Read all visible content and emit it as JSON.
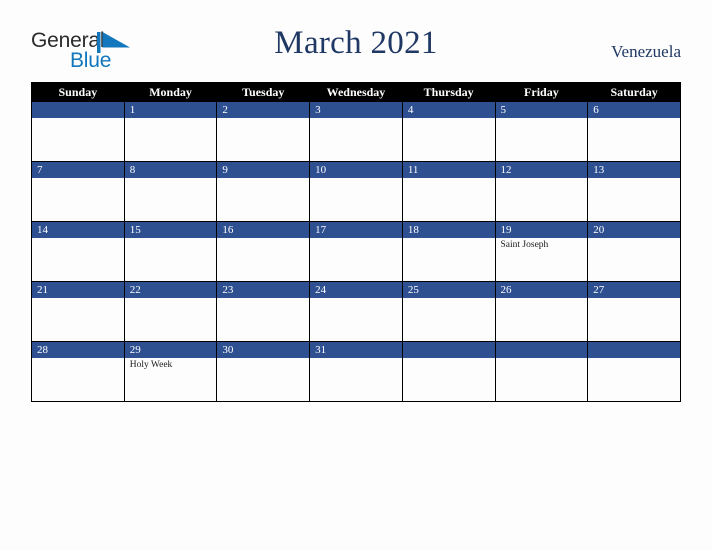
{
  "header": {
    "logo": {
      "word1": "General",
      "word2": "Blue",
      "word1_color": "#2b2b2b",
      "word2_color": "#1277bc",
      "triangle_color": "#1277bc"
    },
    "title": "March 2021",
    "title_color": "#1f3864",
    "country": "Venezuela"
  },
  "theme": {
    "header_row_bg": "#000000",
    "header_row_text": "#ffffff",
    "daynum_band_bg": "#2e5090",
    "daynum_text": "#ffffff",
    "cell_bg": "#fdfdfd",
    "grid_border": "#000000",
    "page_bg": "#fdfdfd"
  },
  "weekday_headers": [
    "Sunday",
    "Monday",
    "Tuesday",
    "Wednesday",
    "Thursday",
    "Friday",
    "Saturday"
  ],
  "weeks": [
    [
      {
        "day": "",
        "events": []
      },
      {
        "day": "1",
        "events": []
      },
      {
        "day": "2",
        "events": []
      },
      {
        "day": "3",
        "events": []
      },
      {
        "day": "4",
        "events": []
      },
      {
        "day": "5",
        "events": []
      },
      {
        "day": "6",
        "events": []
      }
    ],
    [
      {
        "day": "7",
        "events": []
      },
      {
        "day": "8",
        "events": []
      },
      {
        "day": "9",
        "events": []
      },
      {
        "day": "10",
        "events": []
      },
      {
        "day": "11",
        "events": []
      },
      {
        "day": "12",
        "events": []
      },
      {
        "day": "13",
        "events": []
      }
    ],
    [
      {
        "day": "14",
        "events": []
      },
      {
        "day": "15",
        "events": []
      },
      {
        "day": "16",
        "events": []
      },
      {
        "day": "17",
        "events": []
      },
      {
        "day": "18",
        "events": []
      },
      {
        "day": "19",
        "events": [
          "Saint Joseph"
        ]
      },
      {
        "day": "20",
        "events": []
      }
    ],
    [
      {
        "day": "21",
        "events": []
      },
      {
        "day": "22",
        "events": []
      },
      {
        "day": "23",
        "events": []
      },
      {
        "day": "24",
        "events": []
      },
      {
        "day": "25",
        "events": []
      },
      {
        "day": "26",
        "events": []
      },
      {
        "day": "27",
        "events": []
      }
    ],
    [
      {
        "day": "28",
        "events": []
      },
      {
        "day": "29",
        "events": [
          "Holy Week"
        ]
      },
      {
        "day": "30",
        "events": []
      },
      {
        "day": "31",
        "events": []
      },
      {
        "day": "",
        "events": []
      },
      {
        "day": "",
        "events": []
      },
      {
        "day": "",
        "events": []
      }
    ]
  ]
}
